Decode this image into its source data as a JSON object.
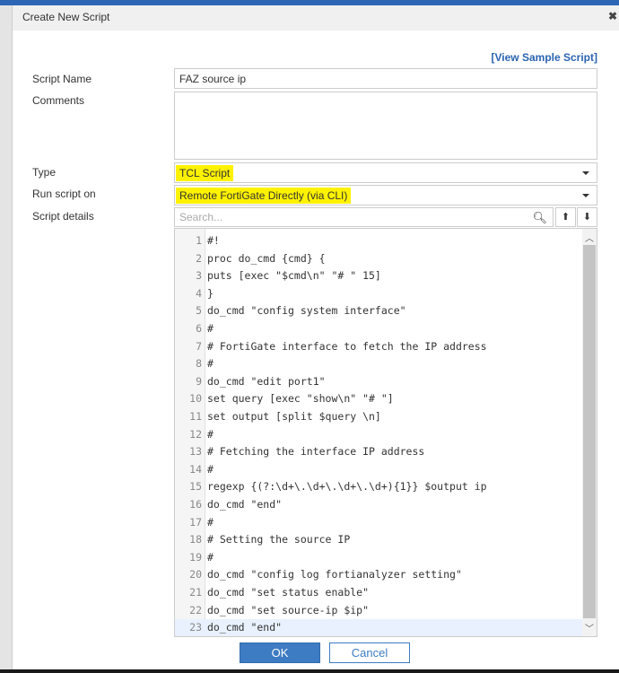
{
  "dialog": {
    "title": "Create New Script",
    "view_sample": "[View Sample Script]"
  },
  "form": {
    "script_name_label": "Script Name",
    "script_name": "FAZ source ip",
    "comments_label": "Comments",
    "comments": "",
    "type_label": "Type",
    "type": "TCL Script",
    "run_on_label": "Run script on",
    "run_on": "Remote FortiGate Directly (via CLI)",
    "details_label": "Script details",
    "search_placeholder": "Search..."
  },
  "code": [
    "#!",
    "proc do_cmd {cmd} {",
    "puts [exec \"$cmd\\n\" \"# \" 15]",
    "}",
    "do_cmd \"config system interface\"",
    "#",
    "# FortiGate interface to fetch the IP address",
    "#",
    "do_cmd \"edit port1\"",
    "set query [exec \"show\\n\" \"# \"]",
    "set output [split $query \\n]",
    "#",
    "# Fetching the interface IP address",
    "#",
    "regexp {(?:\\d+\\.\\d+\\.\\d+\\.\\d+){1}} $output ip",
    "do_cmd \"end\"",
    "#",
    "# Setting the source IP",
    "#",
    "do_cmd \"config log fortianalyzer setting\"",
    "do_cmd \"set status enable\"",
    "do_cmd \"set source-ip $ip\"",
    "do_cmd \"end\""
  ],
  "buttons": {
    "ok": "OK",
    "cancel": "Cancel"
  },
  "colors": {
    "accent": "#3d7cc2",
    "highlight": "#fff200"
  }
}
